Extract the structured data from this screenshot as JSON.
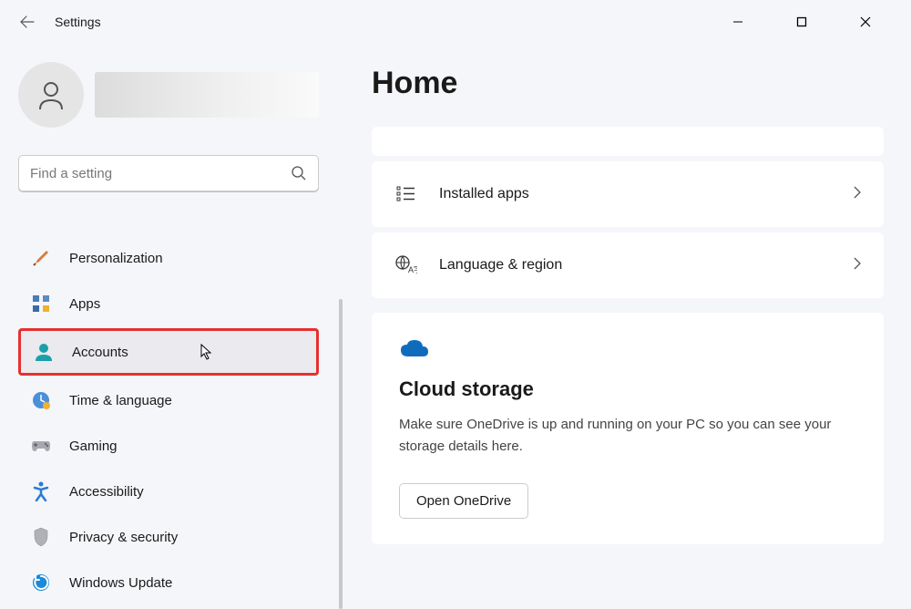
{
  "window": {
    "title": "Settings"
  },
  "sidebar": {
    "search_placeholder": "Find a setting",
    "items": [
      {
        "label": "Personalization"
      },
      {
        "label": "Apps"
      },
      {
        "label": "Accounts"
      },
      {
        "label": "Time & language"
      },
      {
        "label": "Gaming"
      },
      {
        "label": "Accessibility"
      },
      {
        "label": "Privacy & security"
      },
      {
        "label": "Windows Update"
      }
    ]
  },
  "main": {
    "title": "Home",
    "rows": [
      {
        "label": "Installed apps"
      },
      {
        "label": "Language & region"
      }
    ],
    "cloud": {
      "title": "Cloud storage",
      "description": "Make sure OneDrive is up and running on your PC so you can see your storage details here.",
      "button": "Open OneDrive"
    }
  }
}
